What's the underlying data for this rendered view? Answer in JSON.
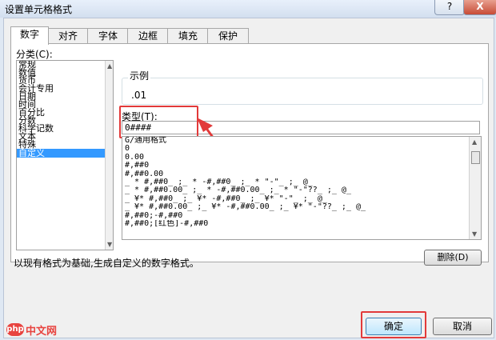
{
  "window": {
    "title": "设置单元格格式",
    "help_label": "?",
    "close_label": "X"
  },
  "tabs": [
    {
      "label": "数字",
      "active": true
    },
    {
      "label": "对齐"
    },
    {
      "label": "字体"
    },
    {
      "label": "边框"
    },
    {
      "label": "填充"
    },
    {
      "label": "保护"
    }
  ],
  "category": {
    "label": "分类(C):",
    "items": [
      "常规",
      "数值",
      "货币",
      "会计专用",
      "日期",
      "时间",
      "百分比",
      "分数",
      "科学记数",
      "文本",
      "特殊",
      "自定义"
    ],
    "selected": "自定义"
  },
  "sample": {
    "label": "示例",
    "value": ".01"
  },
  "type": {
    "label": "类型(T):",
    "value": "0####"
  },
  "formats": [
    "G/通用格式",
    "0",
    "0.00",
    "#,##0",
    "#,##0.00",
    "_ * #,##0_ ;_ * -#,##0_ ;_ * \"-\"_ ;_ @_",
    "_ * #,##0.00_ ;_ * -#,##0.00_ ;_ * \"-\"??_ ;_ @_",
    "_ ¥* #,##0_ ;_ ¥* -#,##0_ ;_ ¥* \"-\"_ ;_ @_",
    "_ ¥* #,##0.00_ ;_ ¥* -#,##0.00_ ;_ ¥* \"-\"??_ ;_ @_",
    "#,##0;-#,##0",
    "#,##0;[红色]-#,##0"
  ],
  "delete_label": "删除(D)",
  "description": "以现有格式为基础,生成自定义的数字格式。",
  "ok_label": "确定",
  "cancel_label": "取消",
  "watermark": {
    "badge": "php",
    "text": "中文网"
  },
  "colors": {
    "highlight": "#e23a3a",
    "selection": "#3399ff"
  }
}
